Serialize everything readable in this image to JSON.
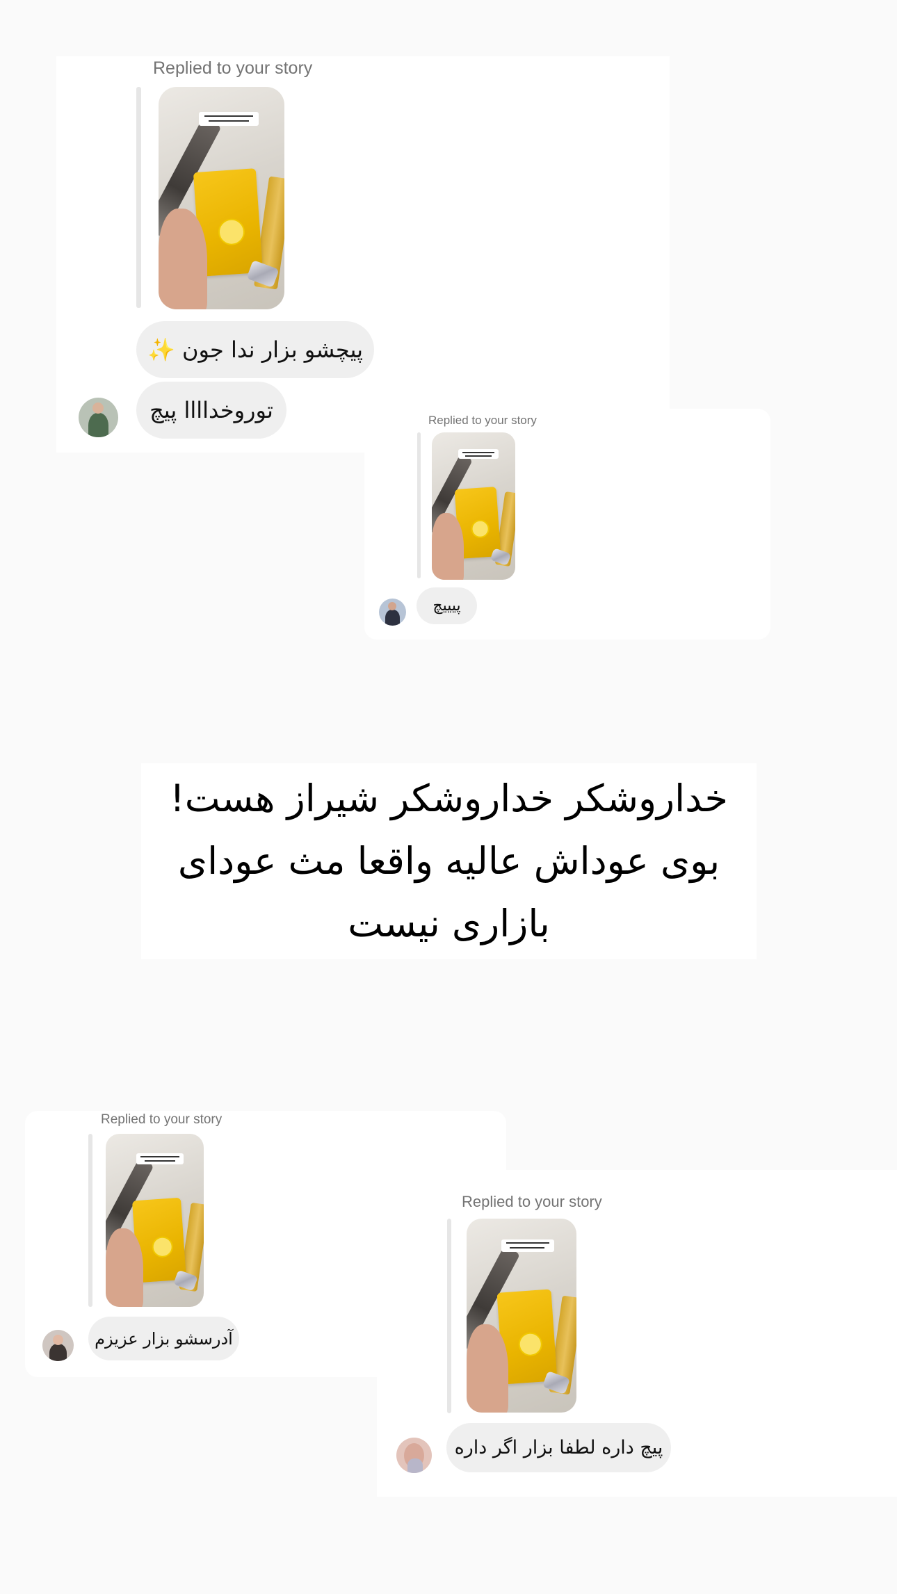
{
  "colors": {
    "page_background": "#fafafa",
    "card_background": "#ffffff",
    "bubble_background": "#efefef",
    "replied_text": "#737373",
    "message_text": "#111111"
  },
  "headline": {
    "line1": "خداروشکر خداروشکر شیراز هست!",
    "line2": "بوی عوداش عالیه واقعا مث عودای",
    "line3": "بازاری نیست"
  },
  "replies": [
    {
      "replied_label": "Replied to your story",
      "messages": [
        "پیچشو بزار ندا جون ✨",
        "توروخداااا پیچ"
      ],
      "avatar_icon": "user-avatar-icon"
    },
    {
      "replied_label": "Replied to your story",
      "messages": [
        "پیییچ"
      ],
      "avatar_icon": "user-avatar-icon"
    },
    {
      "replied_label": "Replied to your story",
      "messages": [
        "آدرسشو بزار عزیزم"
      ],
      "avatar_icon": "user-avatar-icon"
    },
    {
      "replied_label": "Replied to your story",
      "messages": [
        "پیچ داره لطفا بزار اگر داره"
      ],
      "avatar_icon": "user-avatar-icon"
    }
  ]
}
